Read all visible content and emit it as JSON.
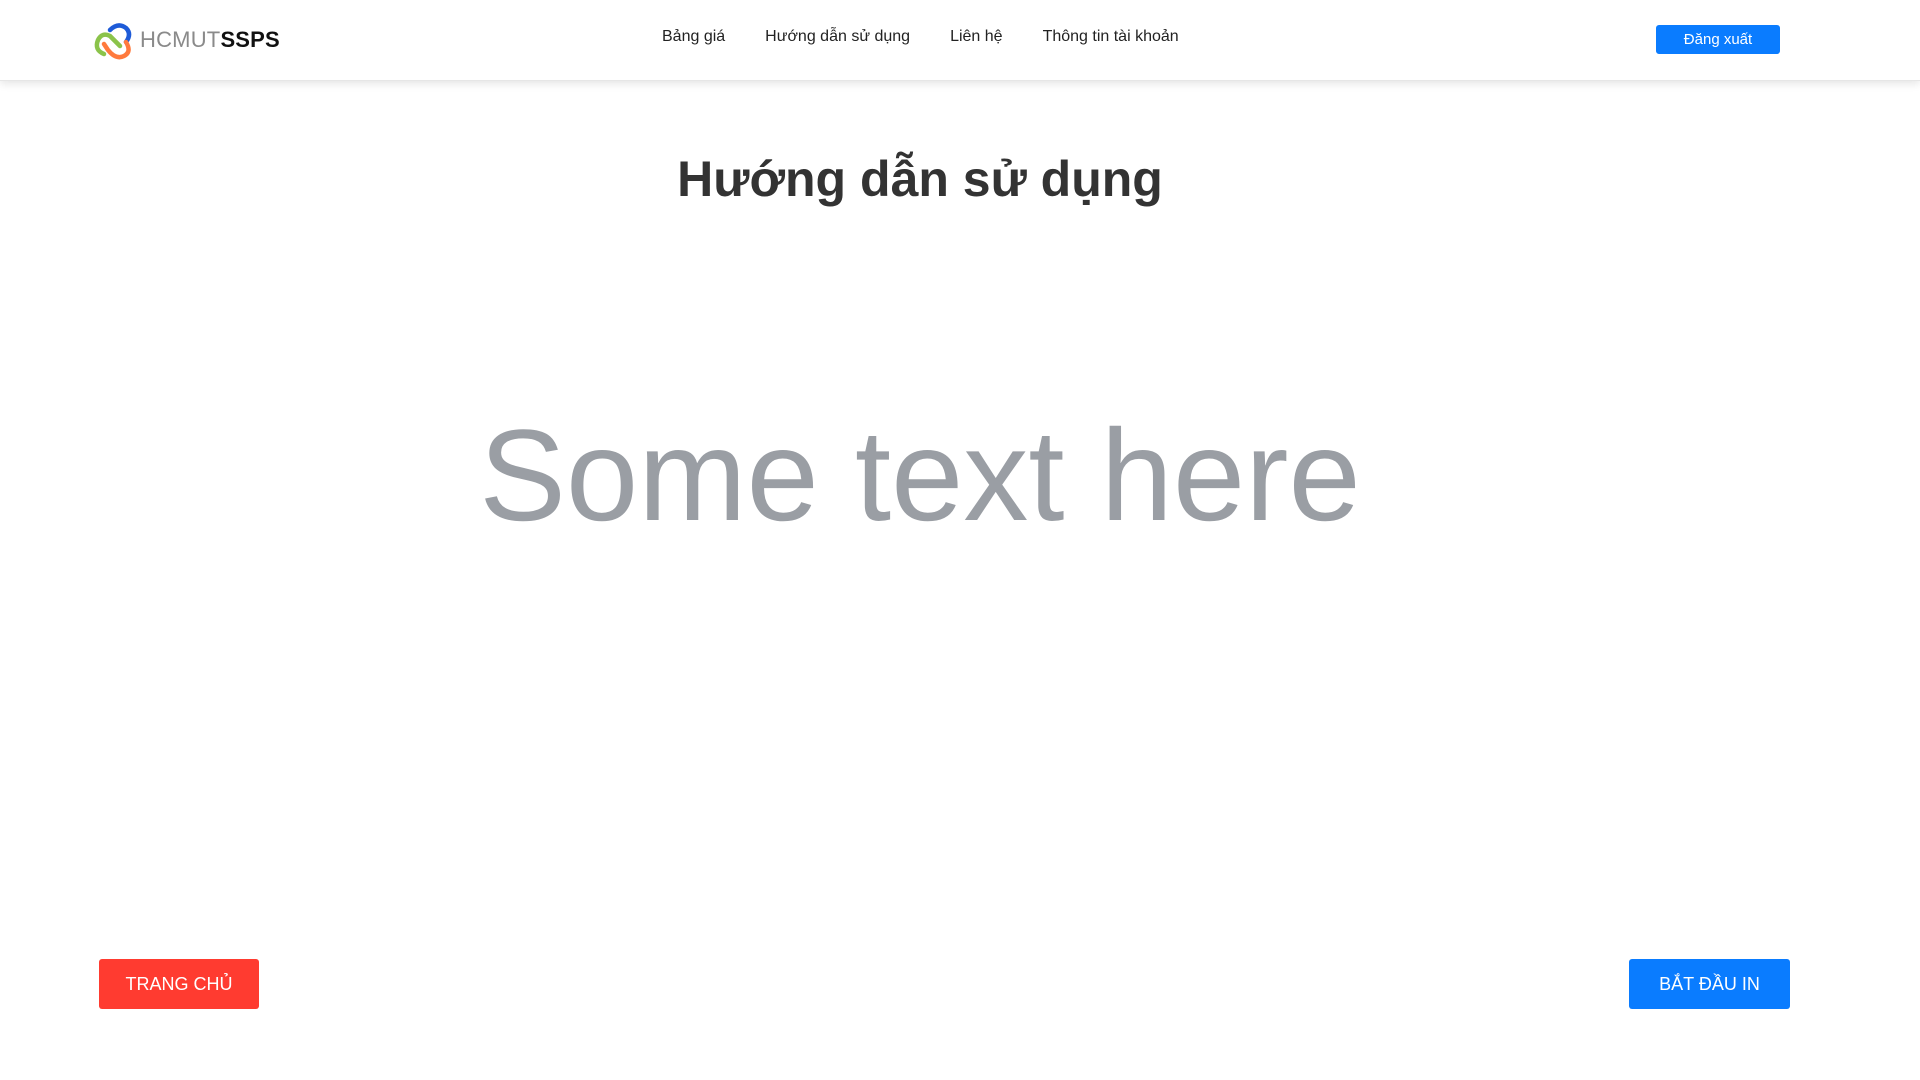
{
  "header": {
    "logo": {
      "text_light": "HCMUT",
      "text_bold": "SSPS",
      "icon": "linked-rings-logo-icon",
      "colors": {
        "green": "#8bc34a",
        "blue": "#1e5bd8",
        "orange": "#ff7a3d"
      }
    },
    "nav": [
      {
        "label": "Bảng giá"
      },
      {
        "label": "Hướng dẫn sử dụng"
      },
      {
        "label": "Liên hệ"
      },
      {
        "label": "Thông tin tài khoản"
      }
    ],
    "logout_label": "Đăng xuất"
  },
  "main": {
    "title": "Hướng dẫn sử dụng",
    "body_text": "Some text here"
  },
  "footer_actions": {
    "home_label": "TRANG CHỦ",
    "print_label": "BẮT ĐẦU IN"
  },
  "colors": {
    "primary": "#0a7cff",
    "danger": "#ff3b30",
    "title": "#333333",
    "placeholder": "#9a9ea4"
  }
}
